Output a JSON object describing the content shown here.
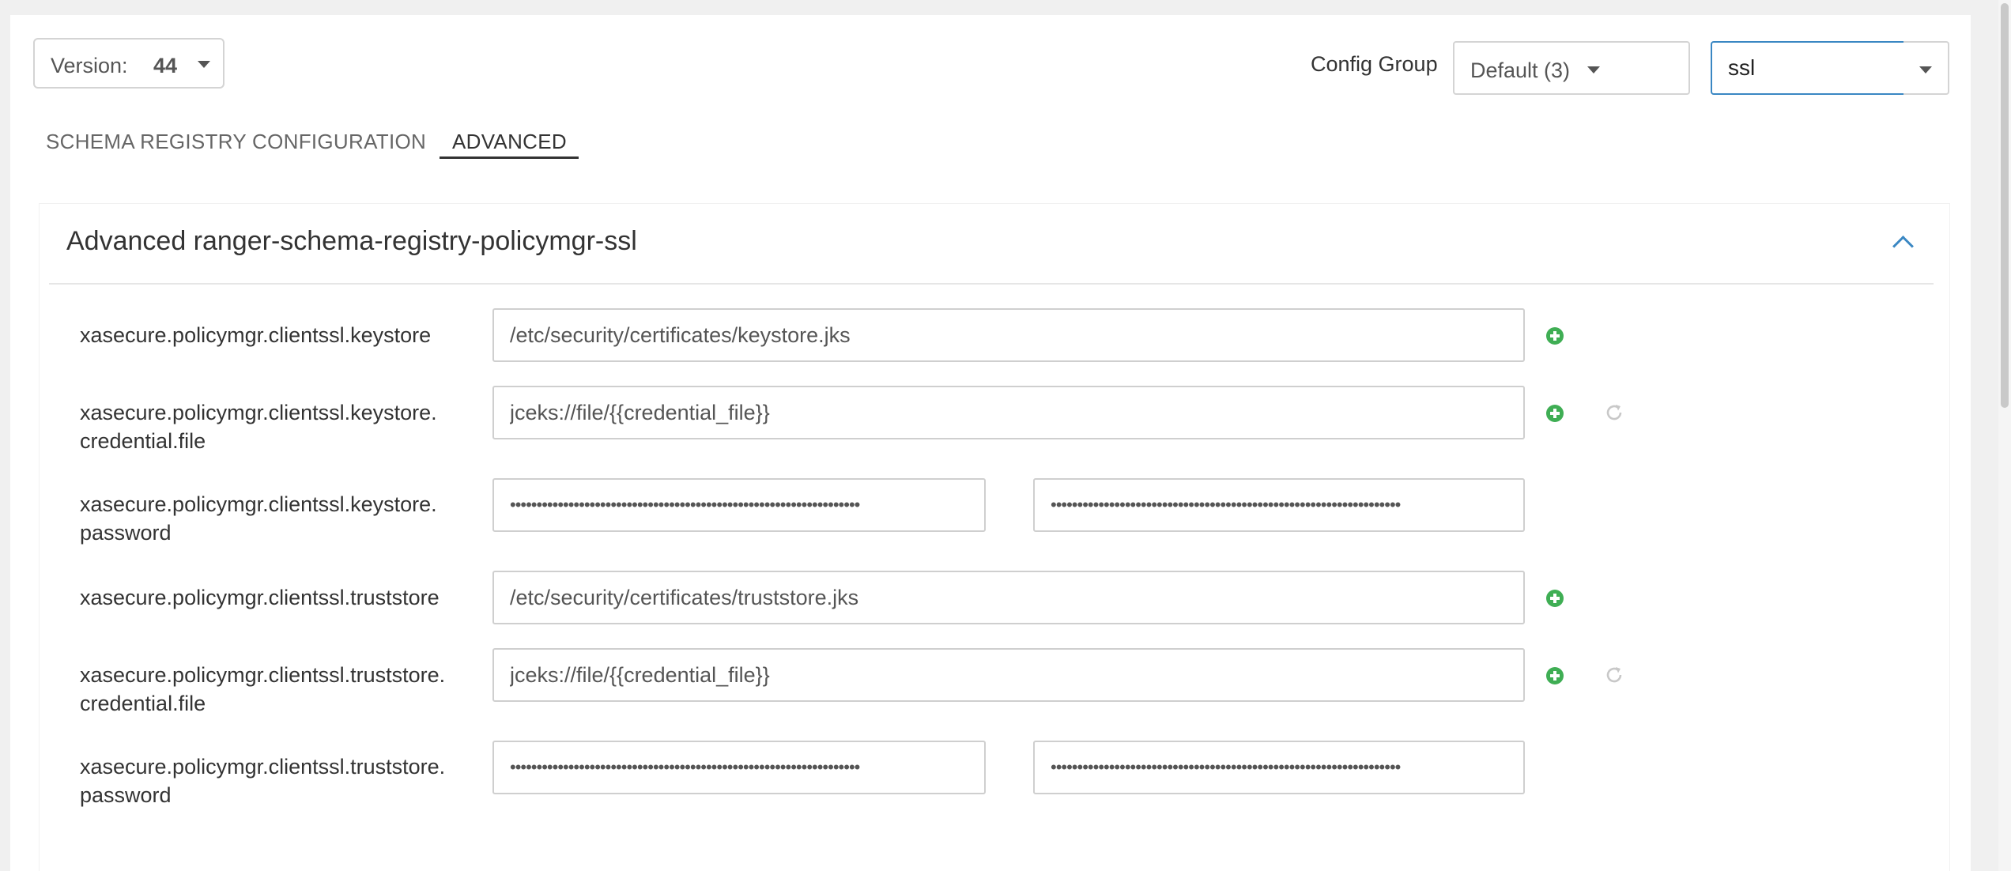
{
  "toolbar": {
    "version_label": "Version:",
    "version_value": "44",
    "config_group_label": "Config Group",
    "config_group_value": "Default (3)",
    "search_value": "ssl"
  },
  "tabs": [
    {
      "label": "SCHEMA REGISTRY CONFIGURATION",
      "active": false
    },
    {
      "label": "ADVANCED",
      "active": true
    }
  ],
  "section": {
    "title": "Advanced ranger-schema-registry-policymgr-ssl",
    "collapse_icon": "chevron-up-icon"
  },
  "properties": [
    {
      "label_line1": "xasecure.policymgr.clientssl.keystore",
      "label_line2": "",
      "value": "/etc/security/certificates/keystore.jks"
    },
    {
      "label_line1": "xasecure.policymgr.clientssl.keystore.",
      "label_line2": "credential.file",
      "value": "jceks://file/{{credential_file}}"
    },
    {
      "label_line1": "xasecure.policymgr.clientssl.keystore.",
      "label_line2": "password",
      "value": "••••••••••••••••••••••••••••••••••••••••••••••••••••••••••••••••••",
      "confirm_value": "••••••••••••••••••••••••••••••••••••••••••••••••••••••••••••••••••"
    },
    {
      "label_line1": "xasecure.policymgr.clientssl.truststore",
      "label_line2": "",
      "value": "/etc/security/certificates/truststore.jks"
    },
    {
      "label_line1": "xasecure.policymgr.clientssl.truststore.",
      "label_line2": "credential.file",
      "value": "jceks://file/{{credential_file}}"
    },
    {
      "label_line1": "xasecure.policymgr.clientssl.truststore.",
      "label_line2": "password",
      "value": "••••••••••••••••••••••••••••••••••••••••••••••••••••••••••••••••••",
      "confirm_value": "••••••••••••••••••••••••••••••••••••••••••••••••••••••••••••••••••"
    }
  ],
  "colors": {
    "accent": "#3a87c3",
    "add_green": "#3fae54",
    "undo_gray": "#c8c8c8"
  }
}
